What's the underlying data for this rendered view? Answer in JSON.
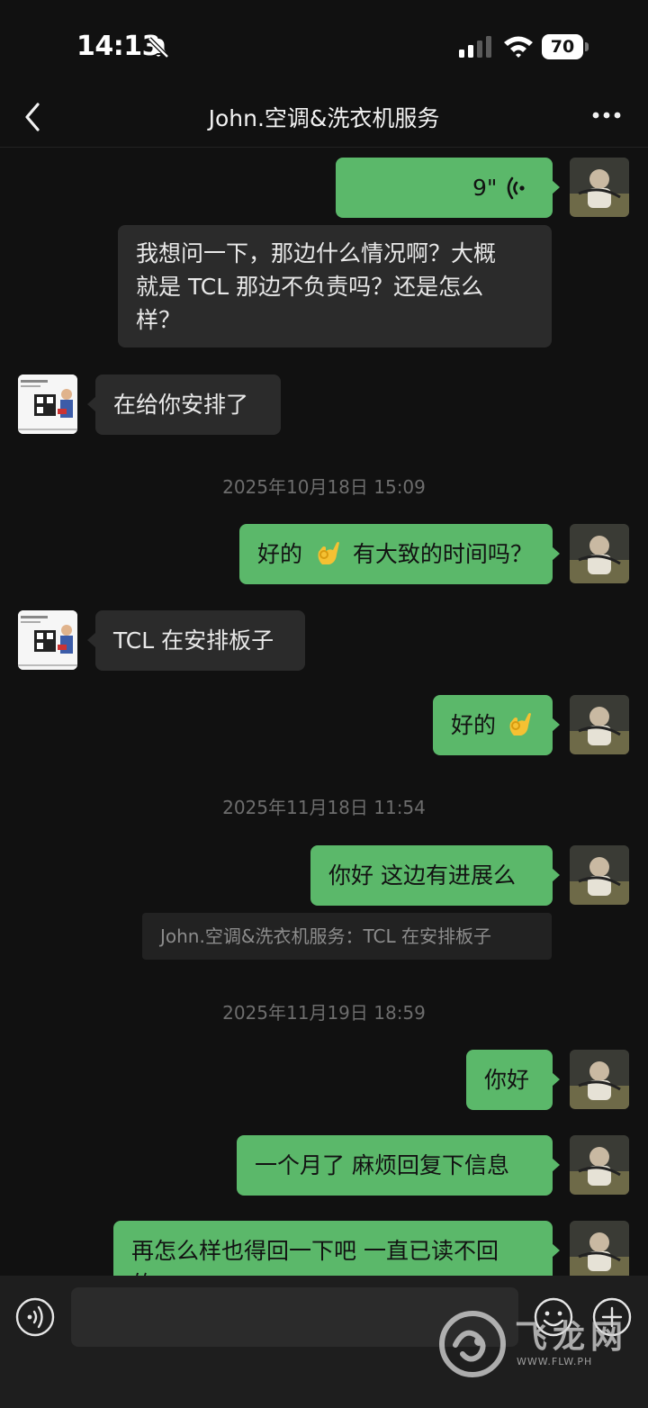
{
  "status_bar": {
    "time": "14:13",
    "battery": "70"
  },
  "nav": {
    "title": "John.空调&洗衣机服务"
  },
  "messages": {
    "voice_duration": "9\"",
    "m1": "我想问一下，那边什么情况啊？大概",
    "m1b": "就是 TCL 那边不负责吗？还是怎么",
    "m1c": "样？",
    "m2": "在给你安排了",
    "t1": "2025年10月18日 15:09",
    "m3": "好的",
    "m3b": "有大致的时间吗？",
    "m4": "TCL 在安排板子",
    "m5": "好的",
    "t2": "2025年11月18日 11:54",
    "m6": "你好 这边有进展么",
    "quote": "John.空调&洗衣机服务：TCL 在安排板子",
    "t3": "2025年11月19日 18:59",
    "m7": "你好",
    "m8": "一个月了 麻烦回复下信息",
    "m9": "再怎么样也得回一下吧 一直已读不回",
    "m9b": "的"
  },
  "watermark": {
    "text": "飞龙网",
    "url": "WWW.FLW.PH"
  },
  "colors": {
    "my_bubble": "#5bb86a",
    "other_bubble": "#2b2b2b",
    "background": "#111111"
  }
}
